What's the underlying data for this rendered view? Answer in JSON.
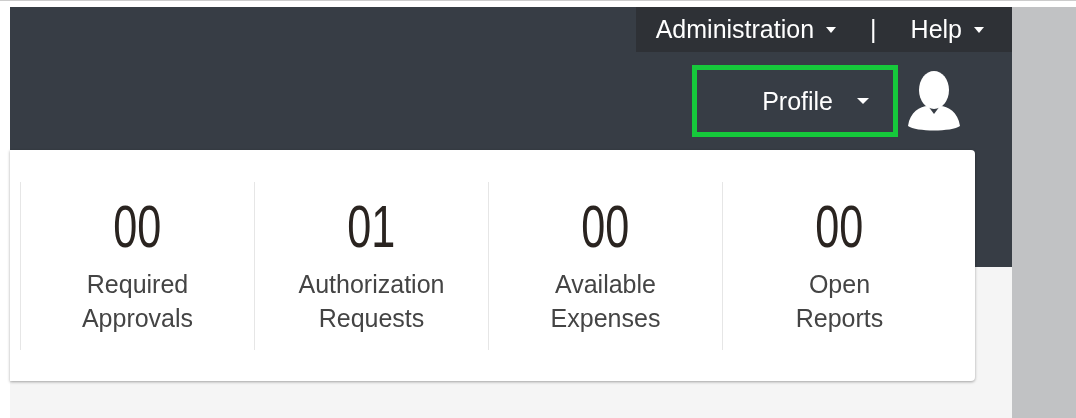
{
  "top_bar": {
    "menus": [
      {
        "label": "Administration"
      },
      {
        "label": "Help"
      }
    ],
    "separator": "|"
  },
  "header": {
    "profile": {
      "label": "Profile",
      "highlighted": true
    }
  },
  "stats": [
    {
      "value": "00",
      "label": "Required Approvals"
    },
    {
      "value": "01",
      "label": "Authorization Requests"
    },
    {
      "value": "00",
      "label": "Available Expenses"
    },
    {
      "value": "00",
      "label": "Open Reports"
    }
  ]
}
